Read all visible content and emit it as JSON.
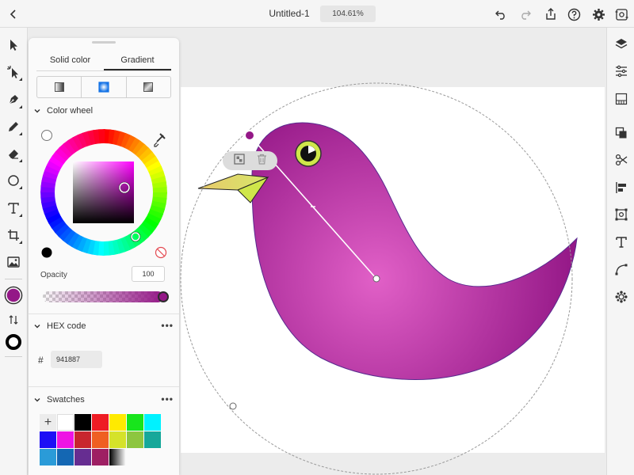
{
  "header": {
    "doc_title": "Untitled-1",
    "zoom": "104.61%",
    "icons": [
      "back-icon",
      "undo-icon",
      "redo-icon",
      "share-icon",
      "help-icon",
      "settings-icon",
      "fit-view-icon"
    ]
  },
  "left_toolbar": {
    "tools": [
      "select-icon",
      "direct-select-icon",
      "pen-icon",
      "pencil-icon",
      "eraser-icon",
      "ellipse-icon",
      "text-icon",
      "crop-icon",
      "image-icon"
    ],
    "fill_color": "#941887",
    "stroke_color": "#000000"
  },
  "right_toolbar": {
    "tools": [
      "layers-icon",
      "properties-icon",
      "libraries-icon",
      "pathfinder-icon",
      "scissors-icon",
      "align-icon",
      "transform-icon",
      "type-icon",
      "curve-icon",
      "plugins-icon"
    ]
  },
  "panel": {
    "tabs": [
      "Solid color",
      "Gradient"
    ],
    "active_tab": "Gradient",
    "gradient_types": [
      "linear-gradient-icon",
      "radial-gradient-icon",
      "freeform-gradient-icon"
    ],
    "color_wheel": {
      "label": "Color wheel",
      "selected_color": "#941887",
      "base_hue": "#ff00ff"
    },
    "opacity": {
      "label": "Opacity",
      "value": "100"
    },
    "hex": {
      "label": "HEX code",
      "prefix": "#",
      "value": "941887"
    },
    "swatches": {
      "label": "Swatches",
      "more": "•••",
      "add": "+",
      "colors": [
        "#ffffff",
        "#000000",
        "#ee1c24",
        "#ffea00",
        "#18e51c",
        "#00f2ff",
        "#1d0ff5",
        "#ee14e4",
        "#c8262e",
        "#ef5f22",
        "#d5e22a",
        "#8dc63f",
        "#16a89a",
        "#2a9bd8",
        "#1467b3",
        "#662d91",
        "#9e1f63",
        "gradient"
      ]
    },
    "more": "•••"
  },
  "canvas": {
    "gradient_colors": [
      "#e160c7",
      "#941887"
    ],
    "beak_colors": [
      "#e8c86a",
      "#d6e86a"
    ],
    "eye_color": "#cfe64a"
  }
}
